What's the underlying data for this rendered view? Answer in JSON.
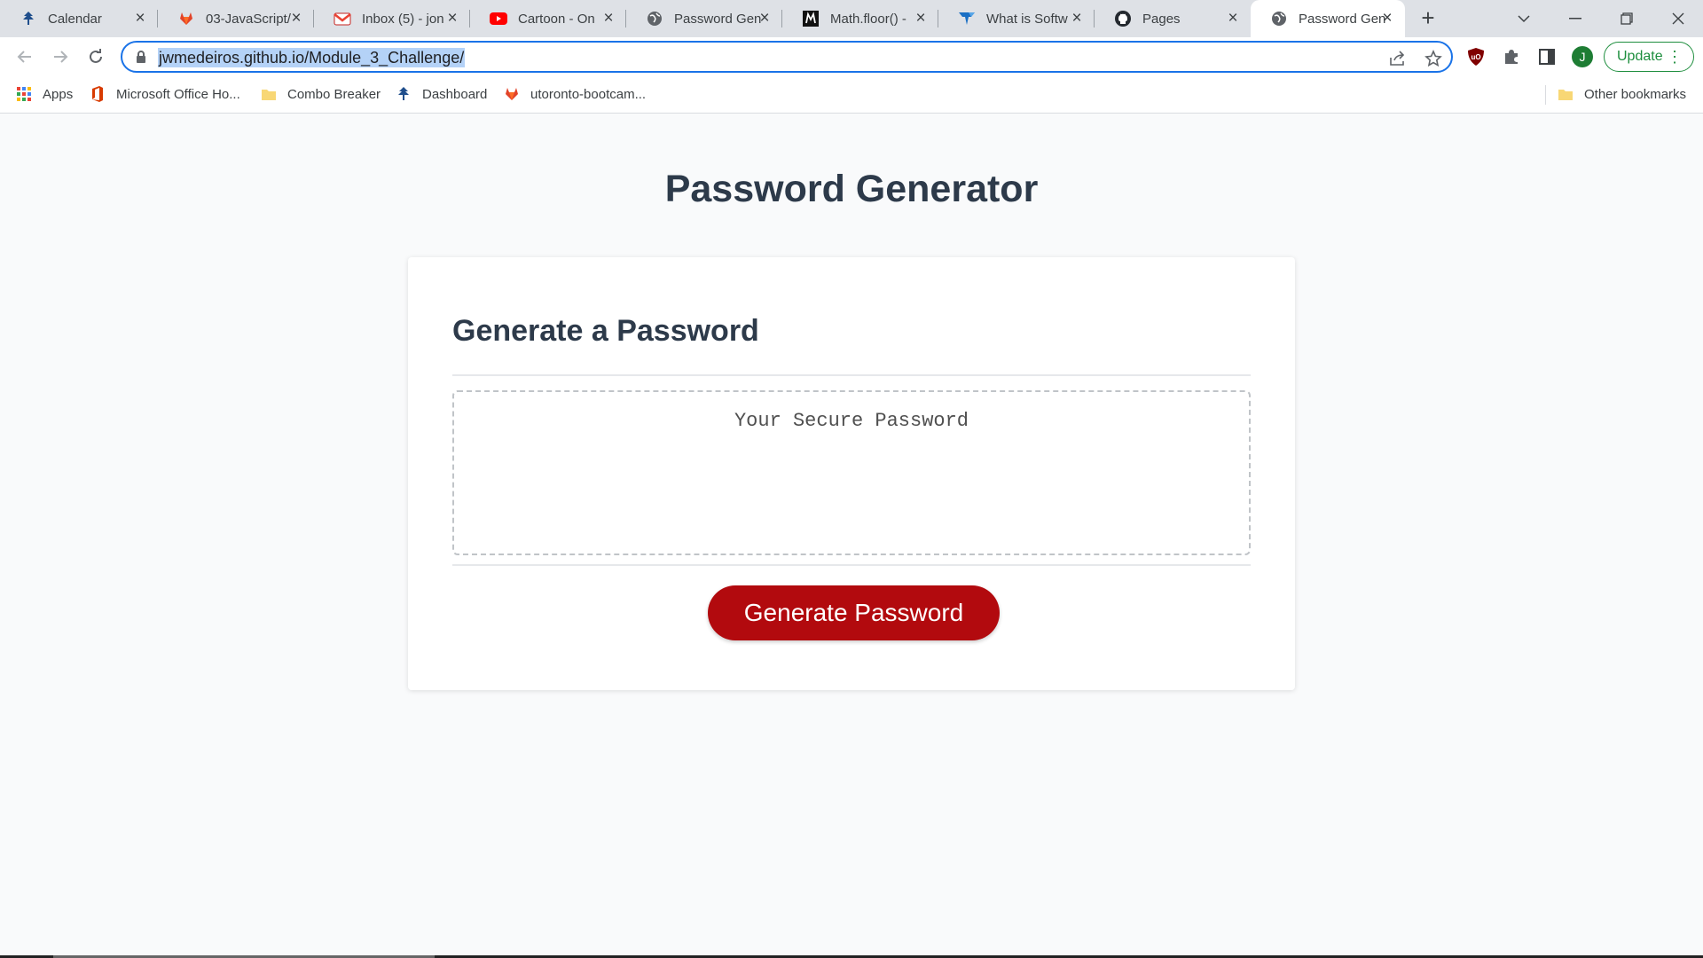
{
  "browser": {
    "tabs": [
      {
        "title": "Calendar",
        "icon": "tree-logo-icon",
        "active": false
      },
      {
        "title": "03-JavaScript/",
        "icon": "gitlab-icon",
        "active": false
      },
      {
        "title": "Inbox (5) - jon",
        "icon": "gmail-icon",
        "active": false
      },
      {
        "title": "Cartoon - On",
        "icon": "youtube-icon",
        "active": false
      },
      {
        "title": "Password Gen",
        "icon": "globe-icon",
        "active": false
      },
      {
        "title": "Math.floor() -",
        "icon": "mdn-icon",
        "active": false
      },
      {
        "title": "What is Softw",
        "icon": "techtarget-icon",
        "active": false
      },
      {
        "title": "Pages",
        "icon": "github-icon",
        "active": false
      },
      {
        "title": "Password Gen",
        "icon": "globe-icon",
        "active": true
      }
    ],
    "address": {
      "url": "jwmedeiros.github.io/Module_3_Challenge/"
    },
    "profile_initial": "J",
    "update_label": "Update",
    "bookmarks": [
      {
        "label": "Apps",
        "icon": "apps-grid-icon"
      },
      {
        "label": "Microsoft Office Ho...",
        "icon": "office-icon"
      },
      {
        "label": "Combo Breaker",
        "icon": "folder-icon"
      },
      {
        "label": "Dashboard",
        "icon": "tree-logo-icon"
      },
      {
        "label": "utoronto-bootcam...",
        "icon": "gitlab-icon"
      }
    ],
    "other_bookmarks": "Other bookmarks"
  },
  "page": {
    "title": "Password Generator",
    "card_heading": "Generate a Password",
    "password_placeholder": "Your Secure Password",
    "generate_button": "Generate Password"
  },
  "colors": {
    "accent_red": "#b20a0e",
    "heading": "#2d3a4a",
    "page_bg": "#f9fafb",
    "omnibox_focus": "#1a73e8"
  }
}
